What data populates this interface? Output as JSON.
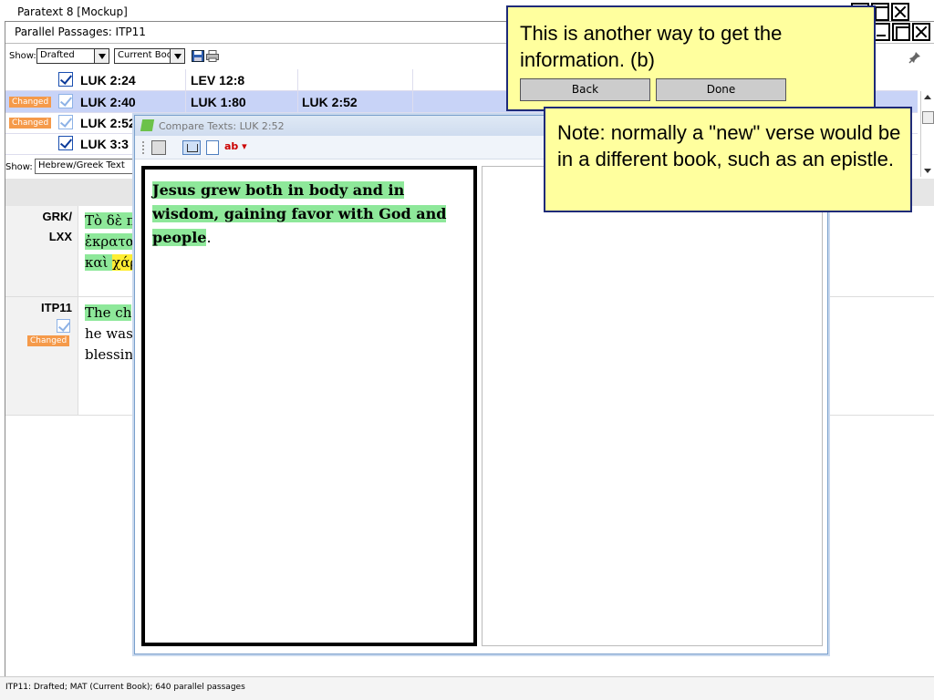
{
  "app": {
    "title": "Paratext 8 [Mockup]"
  },
  "parallel_passages": {
    "title": "Parallel Passages: ITP11",
    "show_label": "Show:",
    "filter_value": "Drafted",
    "scope_value": "Current Book",
    "rows": [
      {
        "badge": "",
        "checked": true,
        "faded": false,
        "refs": [
          "LUK 2:24",
          "LEV 12:8",
          ""
        ]
      },
      {
        "badge": "Changed",
        "checked": true,
        "faded": true,
        "refs": [
          "LUK 2:40",
          "LUK 1:80",
          "LUK 2:52"
        ]
      },
      {
        "badge": "Changed",
        "checked": true,
        "faded": true,
        "refs": [
          "LUK 2:52",
          "",
          ""
        ]
      },
      {
        "badge": "",
        "checked": true,
        "faded": false,
        "refs": [
          "LUK 3:3",
          "",
          ""
        ]
      }
    ],
    "show2_label": "Show:",
    "text_type_value": "Hebrew/Greek Text",
    "text_rows": {
      "grk": {
        "tag_line1": "GRK/",
        "tag_line2": "LXX",
        "line1": "Τὸ δὲ π",
        "line2": "ἐκρατα",
        "line3_a": "καὶ ",
        "line3_b": "χάρ"
      },
      "itp": {
        "tag": "ITP11",
        "badge": "Changed",
        "line1": "The ch",
        "line2": "he was",
        "line3": "blessing"
      }
    },
    "status": "ITP11: Drafted; MAT (Current Book); 640 parallel passages"
  },
  "compare": {
    "title": "Compare Texts: LUK 2:52",
    "ab_label": "ab",
    "left_text_highlighted": "Jesus grew both in body and in wisdom, gaining favor with God and people",
    "left_text_tail": "."
  },
  "callouts": {
    "first": {
      "message": "This is another way to get the information. (b)",
      "back_label": "Back",
      "done_label": "Done"
    },
    "second": {
      "message": "Note: normally a \"new\" verse would be in a different book, such as an epistle."
    }
  },
  "colors": {
    "highlight_green": "#8ee89a",
    "highlight_yellow": "#ffee33",
    "changed_badge": "#f59a4a",
    "callout_bg": "#ffff9e",
    "selected_row": "#c8d3f7"
  }
}
